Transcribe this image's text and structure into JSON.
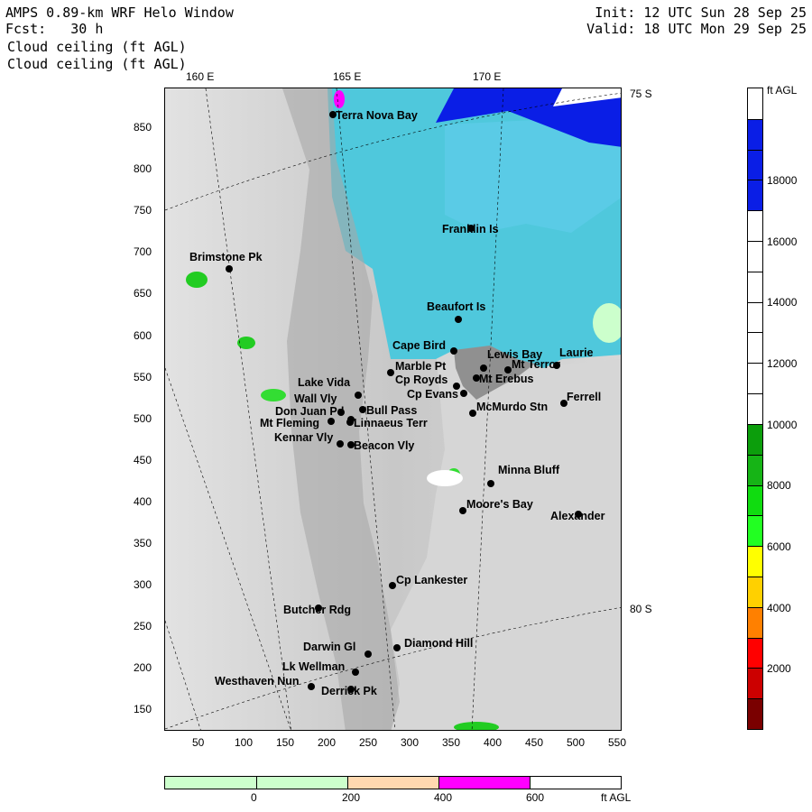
{
  "header": {
    "title_left": "AMPS 0.89-km WRF Helo Window",
    "fcst": "Fcst:   30 h",
    "field1": "Cloud ceiling (ft AGL)",
    "field2": "Cloud ceiling (ft AGL)",
    "init": "Init: 12 UTC Sun 28 Sep 25",
    "valid": "Valid: 18 UTC Mon 29 Sep 25"
  },
  "map": {
    "lon_labels": [
      "160 E",
      "165 E",
      "170 E"
    ],
    "lat_labels": [
      "75 S",
      "80 S"
    ],
    "x_ticks": [
      "50",
      "100",
      "150",
      "200",
      "250",
      "300",
      "350",
      "400",
      "450",
      "500",
      "550"
    ],
    "y_ticks": [
      "850",
      "800",
      "750",
      "700",
      "650",
      "600",
      "550",
      "500",
      "450",
      "400",
      "350",
      "300",
      "250",
      "200",
      "150"
    ],
    "places": [
      {
        "name": "Terra Nova Bay"
      },
      {
        "name": "Franklin Is"
      },
      {
        "name": "Brimstone Pk"
      },
      {
        "name": "Beaufort Is"
      },
      {
        "name": "Cape Bird"
      },
      {
        "name": "Lewis Bay"
      },
      {
        "name": "Laurie"
      },
      {
        "name": "Mt Terror"
      },
      {
        "name": "Marble Pt"
      },
      {
        "name": "Cp Royds"
      },
      {
        "name": "Mt Erebus"
      },
      {
        "name": "Cp Evans"
      },
      {
        "name": "Ferrell"
      },
      {
        "name": "Lake Vida"
      },
      {
        "name": "Wall Vly"
      },
      {
        "name": "Don Juan Pd"
      },
      {
        "name": "Bull Pass"
      },
      {
        "name": "McMurdo Stn"
      },
      {
        "name": "Mt Fleming"
      },
      {
        "name": "Linnaeus Terr"
      },
      {
        "name": "Kennar Vly"
      },
      {
        "name": "Beacon Vly"
      },
      {
        "name": "Minna Bluff"
      },
      {
        "name": "Moore's Bay"
      },
      {
        "name": "Alexander"
      },
      {
        "name": "Cp Lankester"
      },
      {
        "name": "Butcher Rdg"
      },
      {
        "name": "Darwin Gl"
      },
      {
        "name": "Diamond Hill"
      },
      {
        "name": "Lk Wellman"
      },
      {
        "name": "Westhaven Nun"
      },
      {
        "name": "Derrick Pk"
      }
    ]
  },
  "colorbar": {
    "unit": "ft AGL",
    "labels": [
      "18000",
      "16000",
      "14000",
      "12000",
      "10000",
      "8000",
      "6000",
      "4000",
      "2000"
    ],
    "bands_top_to_bottom": [
      "#ffffff",
      "#0a1ee6",
      "#0a1ee6",
      "#0a1ee6",
      "#ffffff",
      "#ffffff",
      "#ffffff",
      "#ffffff",
      "#ffffff",
      "#ffffff",
      "#ffffff",
      "#0c9e0c",
      "#16b416",
      "#10dc10",
      "#22ff22",
      "#ffff00",
      "#ffd000",
      "#ff8000",
      "#ff0000",
      "#cc0000",
      "#7a0000"
    ]
  },
  "hbar": {
    "unit": "ft AGL",
    "labels": [
      "0",
      "200",
      "400",
      "600"
    ],
    "colors": [
      "#ccffcc",
      "#ccffcc",
      "#ffd8b0",
      "#ff00ff",
      "#ffffff"
    ]
  }
}
